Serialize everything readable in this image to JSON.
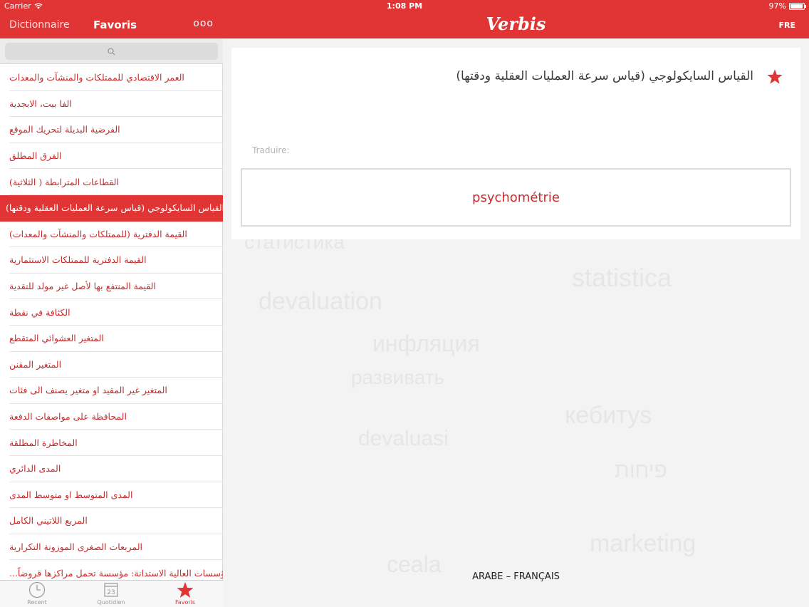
{
  "status_bar": {
    "carrier": "Carrier",
    "time": "1:08 PM",
    "battery": "97%",
    "battery_level": 0.97
  },
  "sidebar": {
    "nav": {
      "dictionary_label": "Dictionnaire",
      "title": "Favoris",
      "more_label": "ooo"
    },
    "search": {
      "placeholder": ""
    },
    "items": [
      {
        "label": "العمر الاقتصادي للممتلكات والمنشآت والمعدات"
      },
      {
        "label": "الفا بيت، الابجدية"
      },
      {
        "label": "الفرضية البديلة لتحريك الموقع"
      },
      {
        "label": "الفرق المطلق"
      },
      {
        "label": "القطاعات المترابطة ( الثلاثية)"
      },
      {
        "label": "القياس السايكولوجي (قياس سرعة العمليات العقلية ودقتها)",
        "selected": true
      },
      {
        "label": "القيمة الدفترية (للممتلكات والمنشآت والمعدات)"
      },
      {
        "label": "القيمة الدفترية للممتلكات الاستثمارية"
      },
      {
        "label": "القيمة المنتفع بها لأصل غير مولد للنقدية"
      },
      {
        "label": "الكثافة في نقطة"
      },
      {
        "label": "المتغير العشوائي المتقطع"
      },
      {
        "label": "المتغير المقنن"
      },
      {
        "label": "المتغير غير المقيد او متغير يصنف الى فئات"
      },
      {
        "label": "المحافظة على مواصفات الدفعة"
      },
      {
        "label": "المخاطرة المطلقة"
      },
      {
        "label": "المدى الدائري"
      },
      {
        "label": "المدى المتوسط او متوسط المدى"
      },
      {
        "label": "المربع اللاتيني الكامل"
      },
      {
        "label": "المربعات الصغرى الموزونة التكرارية"
      },
      {
        "label": "المؤسسات العالية الاستدانة: مؤسسة تحمل مراكزها قروضاً..."
      }
    ],
    "tabs": [
      {
        "label": "Recent",
        "icon": "clock-icon"
      },
      {
        "label": "Quotidien",
        "icon": "calendar-icon",
        "badge": "23"
      },
      {
        "label": "Favoris",
        "icon": "star-icon",
        "active": true
      }
    ]
  },
  "main": {
    "nav": {
      "logo": "Verbis",
      "lang_button": "FRE"
    },
    "entry": {
      "term": "القياس السايكولوجي (قياس سرعة العمليات العقلية ودقتها)",
      "translate_label": "Traduire:",
      "translation": "psychométrie"
    },
    "language_pair": "ARABE – FRANÇAIS",
    "cloud_words": [
      "статистика",
      "statistica",
      "devaluation",
      "инфляция",
      "развивать",
      "кебитуs",
      "devaluasi",
      "פיחות",
      "marketing",
      "ceala"
    ]
  },
  "colors": {
    "brand_red": "#e13535",
    "text_red": "#c72b2b"
  }
}
